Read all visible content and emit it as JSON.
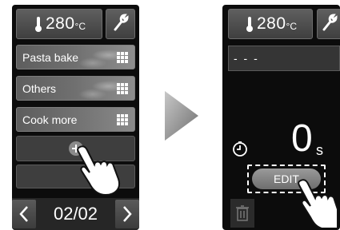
{
  "left_screen": {
    "temperature": {
      "value": "280",
      "unit": "°C"
    },
    "recipes": [
      {
        "label": "Pasta bake"
      },
      {
        "label": "Others"
      },
      {
        "label": "Cook more"
      }
    ],
    "pager": "02/02"
  },
  "right_screen": {
    "temperature": {
      "value": "280",
      "unit": "°C"
    },
    "name_field": "- - -",
    "time": {
      "value": "0",
      "unit": "s"
    },
    "edit_label": "EDIT"
  },
  "icons": {
    "settings": "wrench-icon",
    "grid": "grid-icon",
    "add": "plus-circle-icon",
    "timer": "timer-icon",
    "delete": "trash-icon",
    "touch": "hand-pointer-icon",
    "prev": "chevron-left-icon",
    "next": "chevron-right-icon",
    "flow": "triangle-arrow-icon"
  },
  "colors": {
    "screen_bg": "#0c0c0c",
    "button": "#555555",
    "text": "#ffffff"
  }
}
